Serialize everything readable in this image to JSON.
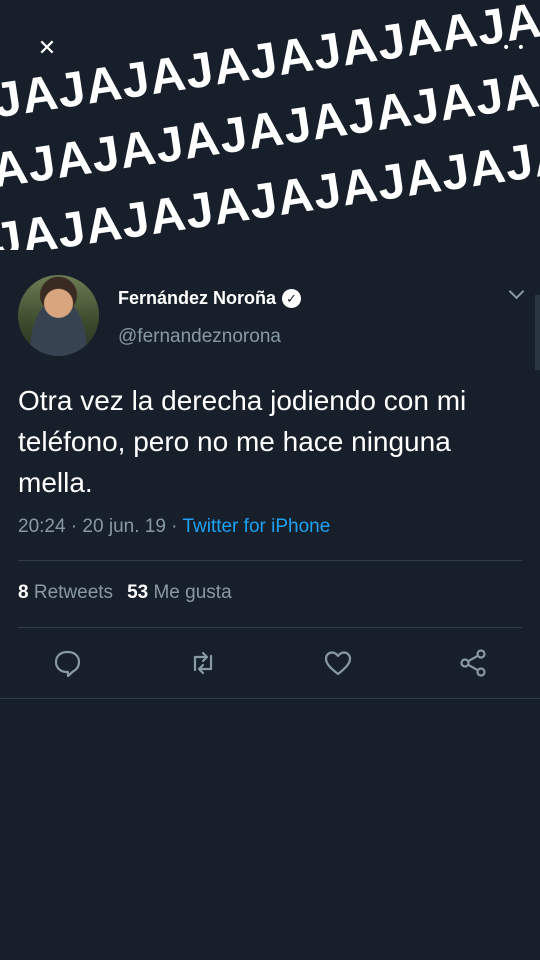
{
  "overlay": {
    "close_glyph": "✕",
    "more_glyph": "• •",
    "lines": [
      "JAJAJAJAJAJAJAAJAJ",
      "AJAJAJAJAJAJAJAJAJA",
      "JAJAJAJAJAJAJAJAJA"
    ]
  },
  "tweet": {
    "author_name": "Fernández Noroña",
    "handle": "@fernandeznorona",
    "verified_glyph": "✓",
    "text": "Otra vez la derecha jodiendo con mi teléfono, pero no me hace ninguna mella.",
    "time": "20:24 · 20 jun. 19 · ",
    "source": "Twitter for iPhone",
    "retweets_count": "8",
    "retweets_label": " Retweets",
    "likes_count": "53",
    "likes_label": " Me gusta"
  },
  "icons": {
    "reply": "reply-icon",
    "retweet": "retweet-icon",
    "like": "heart-icon",
    "share": "share-icon",
    "menu": "chevron-down-icon"
  },
  "colors": {
    "background": "#17202a",
    "secondary_text": "#8899a6",
    "link": "#1da1f2"
  }
}
